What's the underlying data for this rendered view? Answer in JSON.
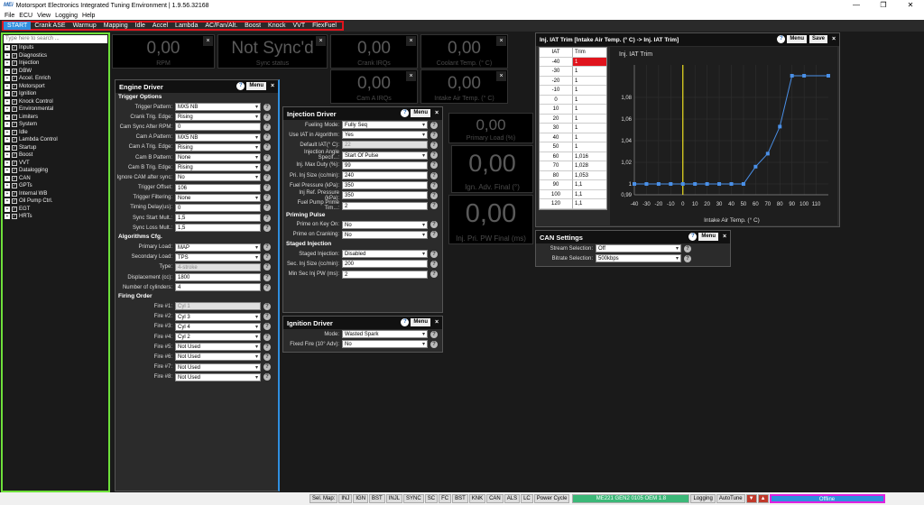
{
  "window": {
    "title": "Motorsport Electronics Integrated Tuning Environment | 1.9.56.32168",
    "logo": "MEi"
  },
  "menu": [
    "File",
    "ECU",
    "View",
    "Logging",
    "Help"
  ],
  "tabs": [
    "START",
    "Crank ASE",
    "Warmup",
    "Mapping",
    "Idle",
    "Accel",
    "Lambda",
    "AC/Fan/Alt.",
    "Boost",
    "Knock",
    "VVT",
    "FlexFuel"
  ],
  "tree": {
    "search_placeholder": "Type here to search ...",
    "items": [
      "Inputs",
      "Diagnostics",
      "Injection",
      "DBW",
      "Accel. Enrich",
      "Motorsport",
      "Ignition",
      "Knock Control",
      "Environmental",
      "Limiters",
      "System",
      "Idle",
      "Lambda Control",
      "Startup",
      "Boost",
      "VVT",
      "Datalogging",
      "CAN",
      "GPTs",
      "Internal WB",
      "Oil Pump Ctrl.",
      "EGT",
      "HRTs"
    ]
  },
  "gauges": {
    "rpm": {
      "value": "0,00",
      "label": "RPM"
    },
    "sync": {
      "value": "Not Sync'd",
      "label": "Sync status"
    },
    "crank_irqs": {
      "value": "0,00",
      "label": "Crank IRQs"
    },
    "coolant": {
      "value": "0,00",
      "label": "Coolant Temp. (° C)"
    },
    "cam_irqs": {
      "value": "0,00",
      "label": "Cam A IRQs"
    },
    "intake_air": {
      "value": "0,00",
      "label": "Intake Air Temp. (° C)"
    },
    "primary_load": {
      "value": "0,00",
      "label": "Primary Load (%)"
    },
    "ign_adv": {
      "value": "0,00",
      "label": "Ign. Adv. Final (°)"
    },
    "inj_pw": {
      "value": "0,00",
      "label": "Inj. Pri. PW Final (ms)"
    }
  },
  "engine_driver": {
    "title": "Engine Driver",
    "menu": "Menu",
    "sections": {
      "trigger": "Trigger Options",
      "algorithms": "Algorithms Cfg.",
      "firing": "Firing Order"
    },
    "trigger_rows": [
      {
        "label": "Trigger Pattern:",
        "value": "MX5 NB",
        "sel": true
      },
      {
        "label": "Crank Trig. Edge:",
        "value": "Rising",
        "sel": true
      },
      {
        "label": "Cam Sync After RPM:",
        "value": "0",
        "sel": false
      },
      {
        "label": "Cam A Pattern:",
        "value": "MX5 NB",
        "sel": true
      },
      {
        "label": "Cam A Trig. Edge:",
        "value": "Rising",
        "sel": true
      },
      {
        "label": "Cam B Pattern:",
        "value": "None",
        "sel": true
      },
      {
        "label": "Cam B Trig. Edge:",
        "value": "Rising",
        "sel": true
      },
      {
        "label": "Ignore CAM after sync:",
        "value": "No",
        "sel": true
      },
      {
        "label": "Trigger Offset:",
        "value": "106",
        "sel": false
      },
      {
        "label": "Trigger Filtering:",
        "value": "None",
        "sel": true
      },
      {
        "label": "Timing Delay(us):",
        "value": "0",
        "sel": false
      },
      {
        "label": "Sync Start Mult.:",
        "value": "1,5",
        "sel": false
      },
      {
        "label": "Sync Loss Mult.:",
        "value": "1,5",
        "sel": false
      }
    ],
    "algo_rows": [
      {
        "label": "Primary Load:",
        "value": "MAP",
        "sel": true
      },
      {
        "label": "Secondary Load:",
        "value": "TPS",
        "sel": true
      },
      {
        "label": "Type:",
        "value": "4-stroke",
        "sel": false,
        "dis": true
      },
      {
        "label": "Displacement (cc):",
        "value": "1800",
        "sel": false
      },
      {
        "label": "Number of cylinders:",
        "value": "4",
        "sel": false
      }
    ],
    "fire_rows": [
      {
        "label": "Fire #1:",
        "value": "Cyl 1",
        "sel": false,
        "dis": true
      },
      {
        "label": "Fire #2:",
        "value": "Cyl 3",
        "sel": true
      },
      {
        "label": "Fire #3:",
        "value": "Cyl 4",
        "sel": true
      },
      {
        "label": "Fire #4:",
        "value": "Cyl 2",
        "sel": true
      },
      {
        "label": "Fire #5:",
        "value": "Not Used",
        "sel": true
      },
      {
        "label": "Fire #6:",
        "value": "Not Used",
        "sel": true
      },
      {
        "label": "Fire #7:",
        "value": "Not Used",
        "sel": true
      },
      {
        "label": "Fire #8:",
        "value": "Not Used",
        "sel": true
      }
    ]
  },
  "injection_driver": {
    "title": "Injection Driver",
    "menu": "Menu",
    "rows": [
      {
        "label": "Fueling Mode:",
        "value": "Fully Seq",
        "sel": true
      },
      {
        "label": "Use IAT in Algorithm:",
        "value": "Yes",
        "sel": true
      },
      {
        "label": "Default IAT(° C):",
        "value": "22",
        "sel": false,
        "dis": true
      },
      {
        "label": "Injection Angle Specif...:",
        "value": "Start Of Pulse",
        "sel": true
      },
      {
        "label": "Inj. Max Duty (%):",
        "value": "99",
        "sel": false
      },
      {
        "label": "Pri. Inj Size (cc/min):",
        "value": "240",
        "sel": false
      },
      {
        "label": "Fuel Pressure (kPa):",
        "value": "350",
        "sel": false
      },
      {
        "label": "Inj Ref. Pressure (kPa):",
        "value": "350",
        "sel": false
      },
      {
        "label": "Fuel Pump Prime Tim...:",
        "value": "2",
        "sel": false
      }
    ],
    "priming_title": "Priming Pulse",
    "priming_rows": [
      {
        "label": "Prime on Key On:",
        "value": "No",
        "sel": true
      },
      {
        "label": "Prime on Cranking:",
        "value": "No",
        "sel": true
      }
    ],
    "staged_title": "Staged Injection",
    "staged_rows": [
      {
        "label": "Staged Injection:",
        "value": "Disabled",
        "sel": true
      },
      {
        "label": "Sec. Inj Size (cc/min):",
        "value": "200",
        "sel": false
      },
      {
        "label": "Min Sec Inj PW (ms):",
        "value": "2",
        "sel": false
      }
    ]
  },
  "ignition_driver": {
    "title": "Ignition Driver",
    "menu": "Menu",
    "rows": [
      {
        "label": "Mode:",
        "value": "Wasted Spark",
        "sel": true
      },
      {
        "label": "Fixed Fire (10° Adv):",
        "value": "No",
        "sel": true
      }
    ]
  },
  "can_settings": {
    "title": "CAN Settings",
    "menu": "Menu",
    "rows": [
      {
        "label": "Stream Selection:",
        "value": "Off",
        "sel": true
      },
      {
        "label": "Bitrate Selection:",
        "value": "500kbps",
        "sel": true
      }
    ]
  },
  "iat_trim": {
    "title": "Inj. IAT Trim [Intake Air Temp. (° C) -> Inj. IAT Trim]",
    "menu": "Menu",
    "save": "Save",
    "col1": "IAT",
    "col2": "Trim",
    "rows": [
      {
        "iat": "-40",
        "trim": "1"
      },
      {
        "iat": "-30",
        "trim": "1"
      },
      {
        "iat": "-20",
        "trim": "1"
      },
      {
        "iat": "-10",
        "trim": "1"
      },
      {
        "iat": "0",
        "trim": "1"
      },
      {
        "iat": "10",
        "trim": "1"
      },
      {
        "iat": "20",
        "trim": "1"
      },
      {
        "iat": "30",
        "trim": "1"
      },
      {
        "iat": "40",
        "trim": "1"
      },
      {
        "iat": "50",
        "trim": "1"
      },
      {
        "iat": "60",
        "trim": "1,016"
      },
      {
        "iat": "70",
        "trim": "1,028"
      },
      {
        "iat": "80",
        "trim": "1,053"
      },
      {
        "iat": "90",
        "trim": "1,1"
      },
      {
        "iat": "100",
        "trim": "1,1"
      },
      {
        "iat": "120",
        "trim": "1,1"
      }
    ]
  },
  "chart_data": {
    "type": "line",
    "title": "Inj. IAT Trim",
    "xlabel": "Intake Air Temp. (° C)",
    "ylabel": "",
    "x": [
      -40,
      -30,
      -20,
      -10,
      0,
      10,
      20,
      30,
      40,
      50,
      60,
      70,
      80,
      90,
      100,
      120
    ],
    "series": [
      {
        "values": [
          1,
          1,
          1,
          1,
          1,
          1,
          1,
          1,
          1,
          1,
          1.016,
          1.028,
          1.053,
          1.1,
          1.1,
          1.1
        ]
      }
    ],
    "xticks": [
      "-40",
      "-30",
      "-20",
      "-10",
      "0",
      "10",
      "20",
      "30",
      "40",
      "50",
      "60",
      "70",
      "80",
      "90",
      "100",
      "110"
    ],
    "yticks": [
      "0,99",
      "1",
      "1,02",
      "1,04",
      "1,06",
      "1,08"
    ],
    "xlim": [
      -40,
      120
    ],
    "ylim": [
      0.99,
      1.11
    ],
    "cursor_x": 0,
    "color": "#4a90e8"
  },
  "status": {
    "items": [
      "Sel. Map:",
      "INJ",
      "IGN",
      "BST",
      "INJL",
      "SYNC",
      "SC",
      "FC",
      "BST",
      "KNK",
      "CAN",
      "ALS",
      "LC",
      "Power Cycle"
    ],
    "ecu": "ME221 GEN2 0105 OEM 1.8",
    "logging": "Logging",
    "autotune": "AutoTune",
    "connection": "Offline"
  }
}
